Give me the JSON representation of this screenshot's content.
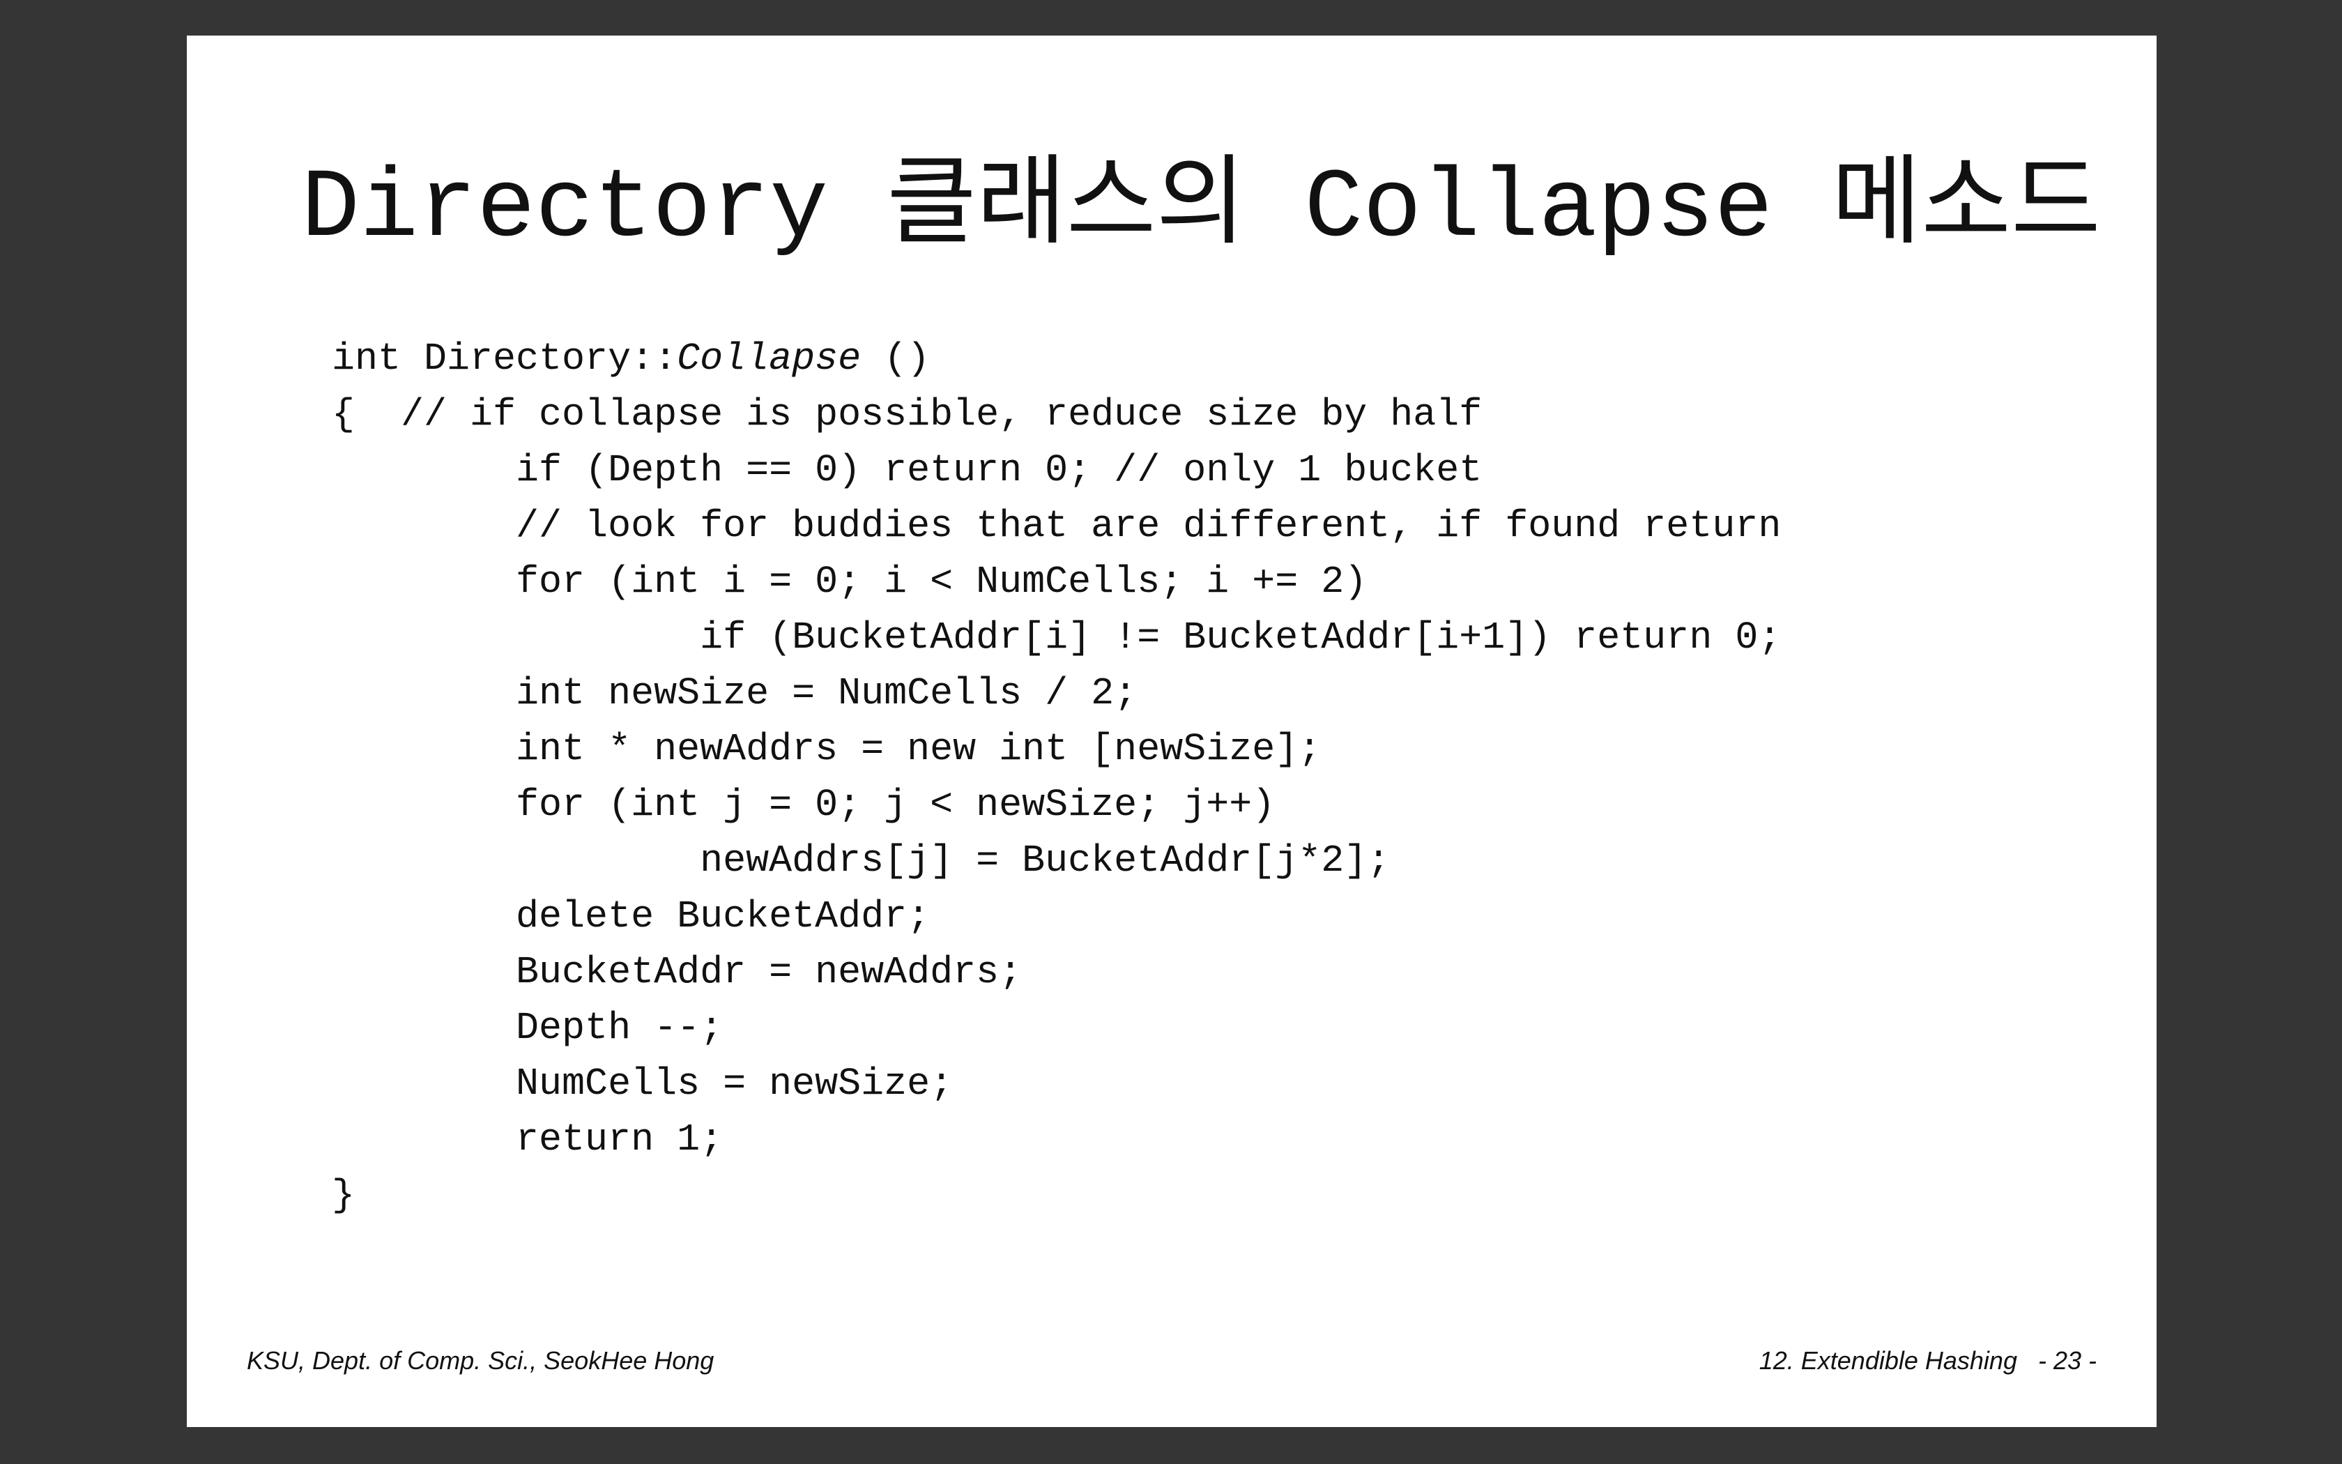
{
  "slide": {
    "title": "Directory 클래스의 Collapse 메소드",
    "code": {
      "signature_prefix": "int Directory::",
      "signature_method": "Collapse",
      "signature_suffix": " ()",
      "lines": [
        "{  // if collapse is possible, reduce size by half",
        "        if (Depth == 0) return 0; // only 1 bucket",
        "        // look for buddies that are different, if found return",
        "        for (int i = 0; i < NumCells; i += 2)",
        "                if (BucketAddr[i] != BucketAddr[i+1]) return 0;",
        "        int newSize = NumCells / 2;",
        "        int * newAddrs = new int [newSize];",
        "        for (int j = 0; j < newSize; j++)",
        "                newAddrs[j] = BucketAddr[j*2];",
        "        delete BucketAddr;",
        "        BucketAddr = newAddrs;",
        "        Depth --;",
        "        NumCells = newSize;",
        "        return 1;",
        "}"
      ]
    },
    "footer": {
      "left": "KSU, Dept. of Comp. Sci., SeokHee Hong",
      "right": "12. Extendible Hashing   - 23 -"
    }
  }
}
